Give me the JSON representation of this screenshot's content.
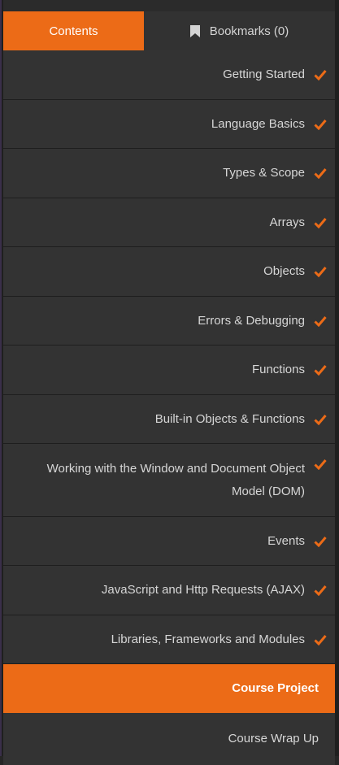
{
  "tabs": {
    "contents_label": "Contents",
    "bookmarks_label": "Bookmarks (0)"
  },
  "chapters": [
    {
      "label": "Getting Started",
      "completed": true
    },
    {
      "label": "Language Basics",
      "completed": true
    },
    {
      "label": "Types & Scope",
      "completed": true
    },
    {
      "label": "Arrays",
      "completed": true
    },
    {
      "label": "Objects",
      "completed": true
    },
    {
      "label": "Errors & Debugging",
      "completed": true
    },
    {
      "label": "Functions",
      "completed": true
    },
    {
      "label": "Built-in Objects & Functions",
      "completed": true
    },
    {
      "label": "Working with the Window and Document Object Model (DOM)",
      "completed": true
    },
    {
      "label": "Events",
      "completed": true
    },
    {
      "label": "JavaScript and Http Requests (AJAX)",
      "completed": true
    },
    {
      "label": "Libraries, Frameworks and Modules",
      "completed": true
    },
    {
      "label": "Course Project",
      "completed": false,
      "current": true
    },
    {
      "label": "Course Wrap Up",
      "completed": false
    }
  ],
  "colors": {
    "accent": "#ec6b17",
    "row_bg": "#333333",
    "text": "#d6d6d6"
  },
  "icons": {
    "bookmark": "bookmark-icon",
    "completed": "check-icon"
  }
}
